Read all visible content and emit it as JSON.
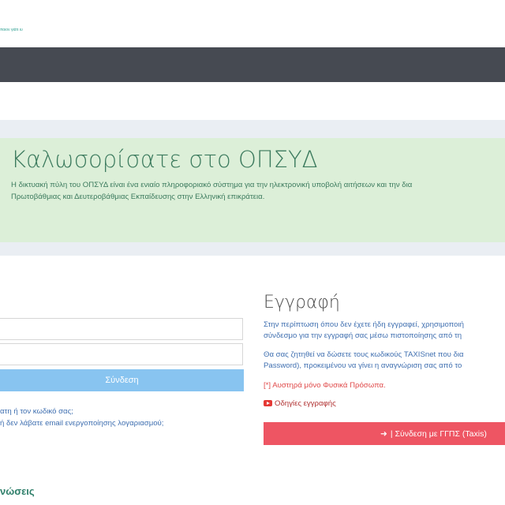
{
  "header": {
    "logo_text": "ποιον γιάτι ιυ"
  },
  "welcome": {
    "title": "Καλωσορίσατε στο ΟΠΣΥΔ",
    "line1": "Η δικτυακή πύλη του ΟΠΣΥΔ είναι ένα ενιαίο πληροφοριακό σύστημα για την ηλεκτρονική υποβολή αιτήσεων και την δια",
    "line2": "Πρωτοβάθμιας και Δευτεροβάθμιας Εκπαίδευσης στην Ελληνική επικράτεια."
  },
  "login": {
    "button_label": "Σύνδεση",
    "forgot_link": "ατη ή τον κωδικό σας;",
    "activation_link": "ή δεν λάβατε email ενεργοποίησης λογαριασμού;"
  },
  "notices": {
    "heading": "νώσεις"
  },
  "registration": {
    "title": "Εγγραφή",
    "p1_line1": "Στην περίπτωση όπου δεν έχετε ήδη εγγραφεί, χρησιμοποιή",
    "p1_line2": "σύνδεσμο για την εγγραφή σας μέσω πιστοποίησης από τη",
    "p2_line1": "Θα σας ζητηθεί να δώσετε τους κωδικούς TAXISnet που δια",
    "p2_line2": "Password), προκειμένου να γίνει η αναγνώριση σας από το",
    "note": "[*] Αυστηρά μόνο Φυσικά Πρόσωπα.",
    "guide_link": "Οδηγίες εγγραφής",
    "taxis_button": "| Σύνδεση με ΓΓΠΣ (Taxis)",
    "taxis_icon": "sign-in-icon"
  },
  "colors": {
    "topbar": "#464a52",
    "welcome_bg": "#dcefd8",
    "login_button": "#88c4f0",
    "taxis_button": "#ee5563"
  }
}
